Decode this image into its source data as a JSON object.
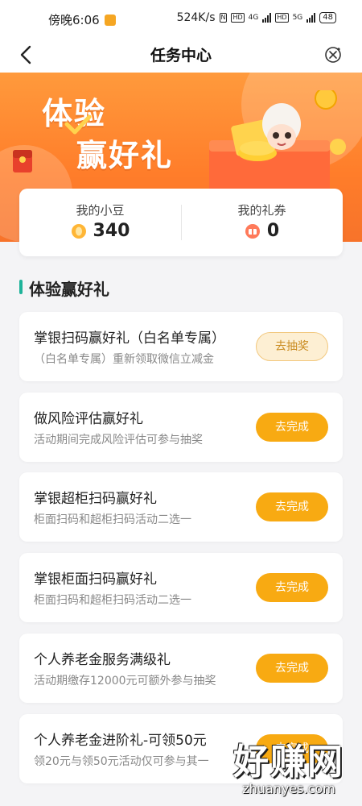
{
  "status_bar": {
    "time": "傍晚6:06",
    "network_speed": "524K/s",
    "net1": "4G",
    "net2": "5G",
    "battery": "48"
  },
  "nav": {
    "title": "任务中心"
  },
  "banner": {
    "title_line1": "体验",
    "title_line2": "赢好礼"
  },
  "beans": {
    "beans_label": "我的小豆",
    "beans_value": "340",
    "coupons_label": "我的礼券",
    "coupons_value": "0"
  },
  "section": {
    "title": "体验赢好礼"
  },
  "tasks": [
    {
      "title": "掌银扫码赢好礼（白名单专属）",
      "subtitle": "（白名单专属）重新领取微信立减金",
      "button": "去抽奖"
    },
    {
      "title": "做风险评估赢好礼",
      "subtitle": "活动期间完成风险评估可参与抽奖",
      "button": "去完成"
    },
    {
      "title": "掌银超柜扫码赢好礼",
      "subtitle": "柜面扫码和超柜扫码活动二选一",
      "button": "去完成"
    },
    {
      "title": "掌银柜面扫码赢好礼",
      "subtitle": "柜面扫码和超柜扫码活动二选一",
      "button": "去完成"
    },
    {
      "title": "个人养老金服务满级礼",
      "subtitle": "活动期缴存12000元可额外参与抽奖",
      "button": "去完成"
    },
    {
      "title": "个人养老金进阶礼-可领50元",
      "subtitle": "领20元与领50元活动仅可参与其一",
      "button": "去完成"
    }
  ],
  "watermark": {
    "text": "好赚网",
    "url": "zhuanyes.com"
  },
  "colors": {
    "accent_orange": "#f8aa12",
    "banner_orange": "#ff7d2a",
    "section_bar_teal": "#1fb39a"
  }
}
